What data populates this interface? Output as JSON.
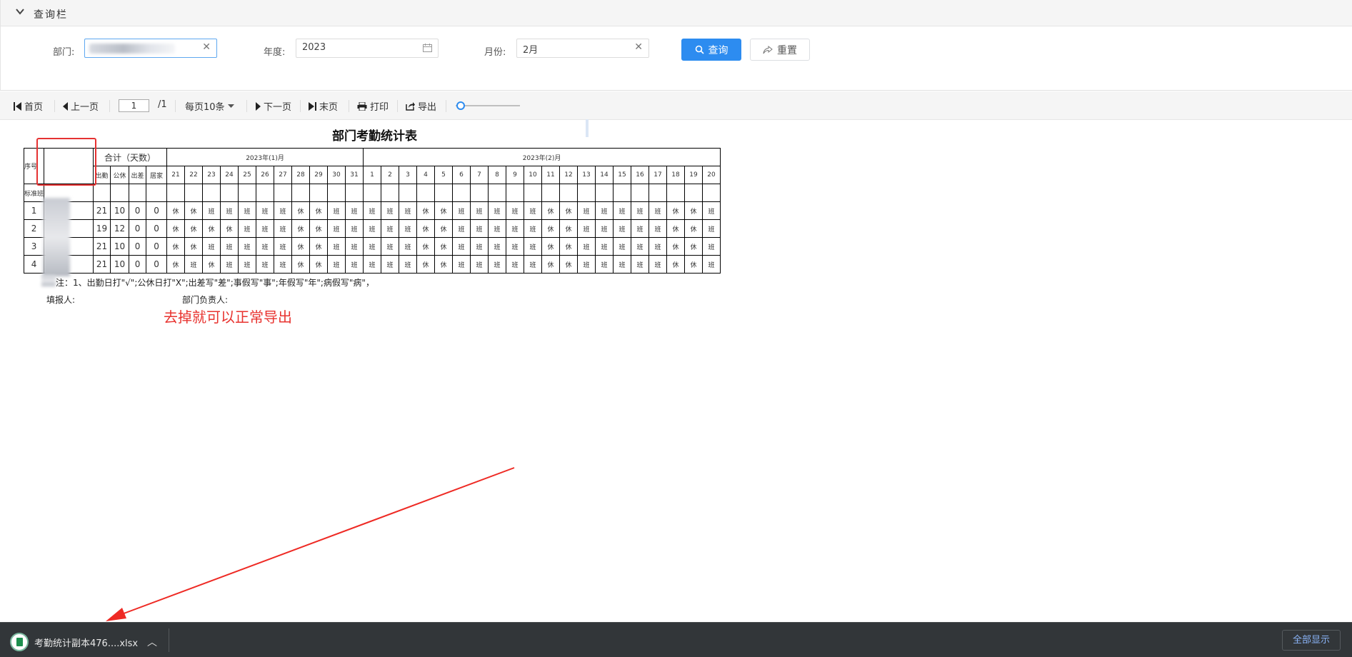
{
  "query_panel": {
    "title": "查询栏",
    "dept_label": "部门:",
    "year_label": "年度:",
    "year_value": "2023",
    "month_label": "月份:",
    "month_value": "2月",
    "search_button": "查询",
    "reset_button": "重置"
  },
  "toolbar": {
    "first": "首页",
    "prev": "上一页",
    "page_current": "1",
    "page_total": "/1",
    "per_page": "每页10条",
    "next": "下一页",
    "last": "末页",
    "print": "打印",
    "export": "导出",
    "zoom_fraction": 0.03
  },
  "report": {
    "title": "部门考勤统计表",
    "col_seq": "序号",
    "total_header": "合计（天数）",
    "totals_cols": [
      "出勤",
      "公休",
      "出差",
      "居家"
    ],
    "month1": "2023年(1)月",
    "month2": "2023年(2)月",
    "days": [
      "21",
      "22",
      "23",
      "24",
      "25",
      "26",
      "27",
      "28",
      "29",
      "30",
      "31",
      "1",
      "2",
      "3",
      "4",
      "5",
      "6",
      "7",
      "8",
      "9",
      "10",
      "11",
      "12",
      "13",
      "14",
      "15",
      "16",
      "17",
      "18",
      "19",
      "20"
    ],
    "group_label": "标准班",
    "rows": [
      {
        "seq": "1",
        "totals": [
          "21",
          "10",
          "0",
          "0"
        ],
        "days": [
          "休",
          "休",
          "班",
          "班",
          "班",
          "班",
          "班",
          "休",
          "休",
          "班",
          "班",
          "班",
          "班",
          "班",
          "休",
          "休",
          "班",
          "班",
          "班",
          "班",
          "班",
          "休",
          "休",
          "班",
          "班",
          "班",
          "班",
          "班",
          "休",
          "休",
          "班"
        ]
      },
      {
        "seq": "2",
        "totals": [
          "19",
          "12",
          "0",
          "0"
        ],
        "days": [
          "休",
          "休",
          "休",
          "休",
          "班",
          "班",
          "班",
          "休",
          "休",
          "班",
          "班",
          "班",
          "班",
          "班",
          "休",
          "休",
          "班",
          "班",
          "班",
          "班",
          "班",
          "休",
          "休",
          "班",
          "班",
          "班",
          "班",
          "班",
          "休",
          "休",
          "班"
        ]
      },
      {
        "seq": "3",
        "totals": [
          "21",
          "10",
          "0",
          "0"
        ],
        "days": [
          "休",
          "休",
          "班",
          "班",
          "班",
          "班",
          "班",
          "休",
          "休",
          "班",
          "班",
          "班",
          "班",
          "班",
          "休",
          "休",
          "班",
          "班",
          "班",
          "班",
          "班",
          "休",
          "休",
          "班",
          "班",
          "班",
          "班",
          "班",
          "休",
          "休",
          "班"
        ]
      },
      {
        "seq": "4",
        "totals": [
          "21",
          "10",
          "0",
          "0"
        ],
        "days": [
          "休",
          "班",
          "休",
          "班",
          "班",
          "班",
          "班",
          "休",
          "休",
          "班",
          "班",
          "班",
          "班",
          "班",
          "休",
          "休",
          "班",
          "班",
          "班",
          "班",
          "班",
          "休",
          "休",
          "班",
          "班",
          "班",
          "班",
          "班",
          "休",
          "休",
          "班"
        ]
      }
    ],
    "note": "注：1、出勤日打\"√\";公休日打\"X\";出差写\"差\";事假写\"事\";年假写\"年\";病假写\"病\"，",
    "filler": "填报人:",
    "dept_head": "部门负责人:"
  },
  "annotation": "去掉就可以正常导出",
  "download_bar": {
    "filename": "考勤统计副本476....xlsx",
    "show_all": "全部显示"
  },
  "colors": {
    "primary": "#2d8cf0",
    "annotation_red": "#e8332f",
    "download_bar": "#323639"
  }
}
